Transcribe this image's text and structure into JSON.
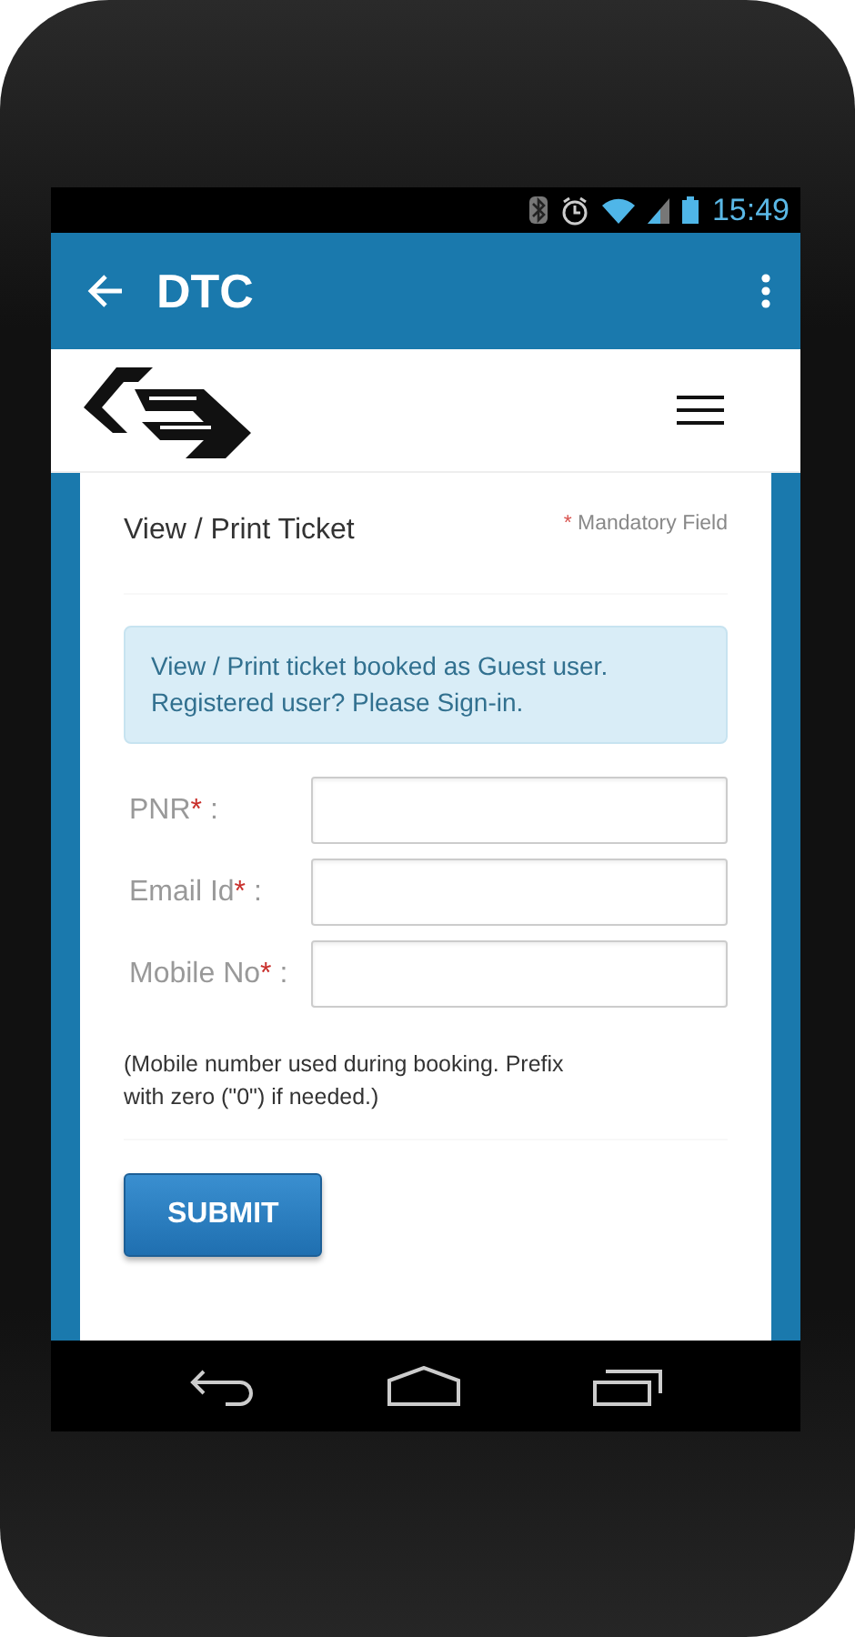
{
  "status_bar": {
    "time": "15:49"
  },
  "app_bar": {
    "title": "DTC"
  },
  "form": {
    "title": "View / Print Ticket",
    "mandatory_note": {
      "mark": "*",
      "text": "Mandatory Field"
    },
    "info": "View / Print ticket booked as Guest user. Registered user? Please Sign-in.",
    "fields": [
      {
        "label": "PNR",
        "mark": "*",
        "suffix": ":"
      },
      {
        "label": "Email Id",
        "mark": "*",
        "suffix": ":"
      },
      {
        "label": "Mobile No",
        "mark": "*",
        "suffix": ":"
      }
    ],
    "hint": "(Mobile number used during booking. Prefix with zero (\"0\") if needed.)",
    "submit": "SUBMIT"
  }
}
